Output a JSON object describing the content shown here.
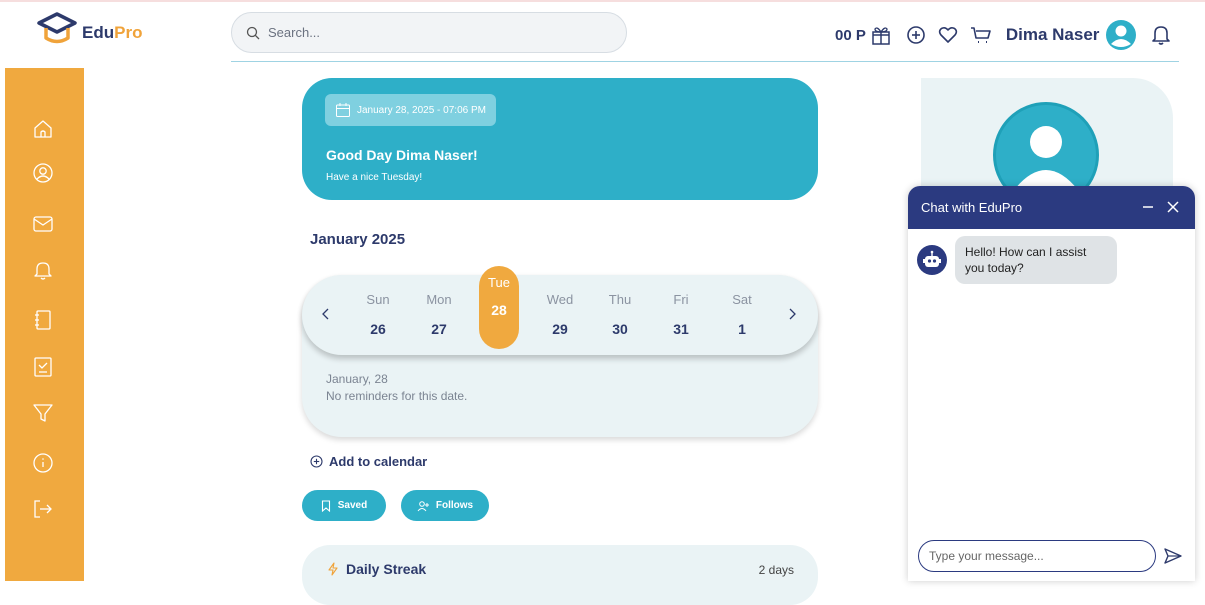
{
  "app": {
    "logo_text_a": "Edu",
    "logo_text_b": "Pro"
  },
  "search": {
    "placeholder": "Search..."
  },
  "header": {
    "points": "00 P",
    "username": "Dima Naser"
  },
  "sidebar": {
    "items": [
      "home-icon",
      "profile-icon",
      "mail-icon",
      "bell-icon",
      "notebook-icon",
      "checklist-icon",
      "filter-icon",
      "info-icon",
      "logout-icon"
    ]
  },
  "hero": {
    "date": "January 28, 2025 - 07:06 PM",
    "greeting": "Good Day Dima Naser!",
    "subtext": "Have a nice Tuesday!"
  },
  "calendar": {
    "month": "January 2025",
    "days": [
      {
        "name": "Sun",
        "date": "26"
      },
      {
        "name": "Mon",
        "date": "27"
      },
      {
        "name": "Tue",
        "date": "28"
      },
      {
        "name": "Wed",
        "date": "29"
      },
      {
        "name": "Thu",
        "date": "30"
      },
      {
        "name": "Fri",
        "date": "31"
      },
      {
        "name": "Sat",
        "date": "1"
      }
    ],
    "selected_index": 2,
    "reminder_date": "January, 28",
    "reminder_text": "No reminders for this date.",
    "add_label": "Add to calendar"
  },
  "buttons": {
    "saved": "Saved",
    "follows": "Follows"
  },
  "streak": {
    "title": "Daily Streak",
    "value": "2 days"
  },
  "chat": {
    "title": "Chat with EduPro",
    "message": "Hello! How can I assist you today?",
    "input_placeholder": "Type your message..."
  },
  "colors": {
    "accent": "#2eafc8",
    "orange": "#f0a93f",
    "navy": "#2b3a80",
    "text": "#2d3a6b"
  }
}
